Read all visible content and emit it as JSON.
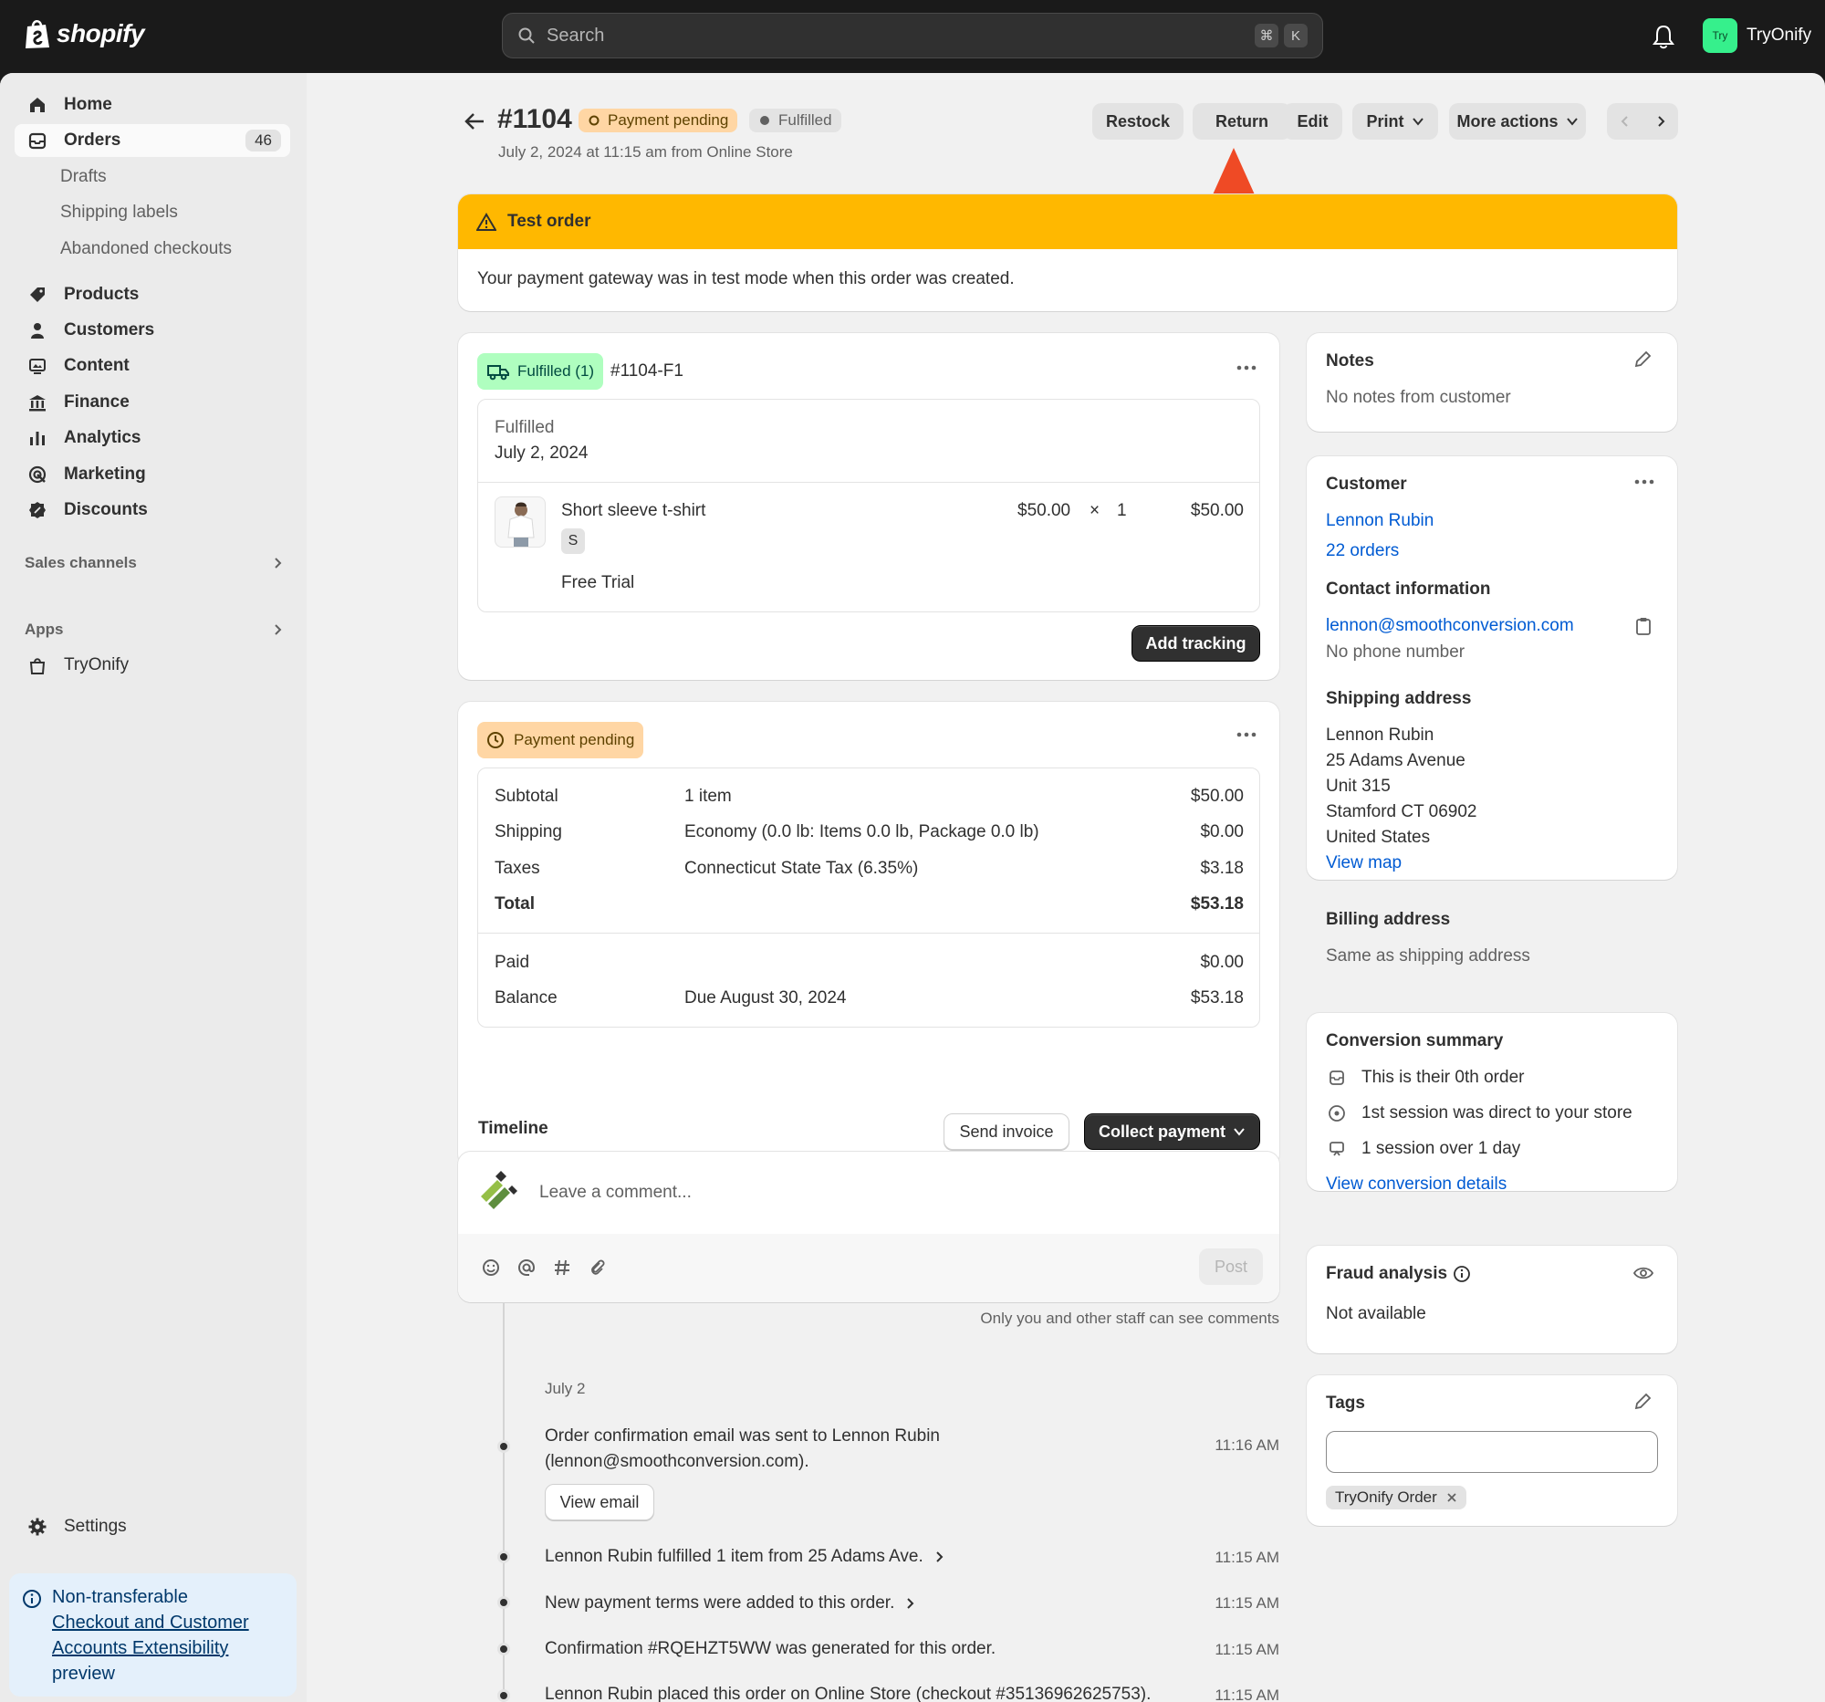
{
  "topbar": {
    "logo_text": "shopify",
    "search_placeholder": "Search",
    "shortcut_keys": [
      "⌘",
      "K"
    ],
    "store_avatar": "Try",
    "store_name": "TryOnify"
  },
  "sidebar": {
    "items": [
      {
        "label": "Home",
        "icon": "home-icon"
      },
      {
        "label": "Orders",
        "icon": "orders-icon",
        "badge": "46"
      },
      {
        "label": "Products",
        "icon": "tag-icon"
      },
      {
        "label": "Customers",
        "icon": "person-icon"
      },
      {
        "label": "Content",
        "icon": "content-icon"
      },
      {
        "label": "Finance",
        "icon": "bank-icon"
      },
      {
        "label": "Analytics",
        "icon": "bar-chart-icon"
      },
      {
        "label": "Marketing",
        "icon": "target-icon"
      },
      {
        "label": "Discounts",
        "icon": "discount-icon"
      }
    ],
    "order_subitems": [
      "Drafts",
      "Shipping labels",
      "Abandoned checkouts"
    ],
    "sales_channels": "Sales channels",
    "apps": "Apps",
    "app_item": "TryOnify",
    "settings": "Settings",
    "promo": {
      "line1": "Non-transferable",
      "link": "Checkout and Customer Accounts Extensibility",
      "line3": "preview"
    }
  },
  "order": {
    "number": "#1104",
    "payment_status": "Payment pending",
    "fulfillment_status": "Fulfilled",
    "subtitle": "July 2, 2024 at 11:15 am from Online Store"
  },
  "actions": {
    "restock": "Restock",
    "return": "Return",
    "edit": "Edit",
    "print": "Print",
    "more": "More actions"
  },
  "test_banner": {
    "title": "Test order",
    "body": "Your payment gateway was in test mode when this order was created."
  },
  "fulfillment": {
    "badge": "Fulfilled (1)",
    "id": "#1104-F1",
    "status": "Fulfilled",
    "date": "July 2, 2024",
    "item": {
      "name": "Short sleeve t-shirt",
      "variant": "S",
      "plan": "Free Trial",
      "price": "$50.00",
      "times": "×",
      "qty": "1",
      "total": "$50.00"
    },
    "add_tracking": "Add tracking"
  },
  "payment": {
    "badge": "Payment pending",
    "rows": [
      {
        "label": "Subtotal",
        "desc": "1 item",
        "amount": "$50.00"
      },
      {
        "label": "Shipping",
        "desc": "Economy (0.0 lb: Items 0.0 lb, Package 0.0 lb)",
        "amount": "$0.00"
      },
      {
        "label": "Taxes",
        "desc": "Connecticut State Tax (6.35%)",
        "amount": "$3.18"
      },
      {
        "label": "Total",
        "desc": "",
        "amount": "$53.18"
      }
    ],
    "paid_label": "Paid",
    "paid_amount": "$0.00",
    "balance_label": "Balance",
    "balance_desc": "Due August 30, 2024",
    "balance_amount": "$53.18",
    "send_invoice": "Send invoice",
    "collect_payment": "Collect payment"
  },
  "timeline": {
    "title": "Timeline",
    "comment_placeholder": "Leave a comment...",
    "post": "Post",
    "staff_note": "Only you and other staff can see comments",
    "date": "July 2",
    "events": [
      {
        "text": "Order confirmation email was sent to Lennon Rubin (lennon@smoothconversion.com).",
        "time": "11:16 AM",
        "action": "View email"
      },
      {
        "text": "Lennon Rubin fulfilled 1 item from 25 Adams Ave.",
        "time": "11:15 AM"
      },
      {
        "text": "New payment terms were added to this order.",
        "time": "11:15 AM"
      },
      {
        "text": "Confirmation #RQEHZT5WW was generated for this order.",
        "time": "11:15 AM"
      },
      {
        "text": "Lennon Rubin placed this order on Online Store (checkout #35136962625753).",
        "time": "11:15 AM"
      }
    ]
  },
  "notes": {
    "title": "Notes",
    "body": "No notes from customer"
  },
  "customer": {
    "title": "Customer",
    "name": "Lennon Rubin",
    "orders": "22 orders",
    "contact_title": "Contact information",
    "email": "lennon@smoothconversion.com",
    "phone": "No phone number",
    "shipping_title": "Shipping address",
    "address": [
      "Lennon Rubin",
      "25 Adams Avenue",
      "Unit 315",
      "Stamford CT 06902",
      "United States"
    ],
    "view_map": "View map",
    "billing_title": "Billing address",
    "billing": "Same as shipping address"
  },
  "conversion": {
    "title": "Conversion summary",
    "lines": [
      "This is their 0th order",
      "1st session was direct to your store",
      "1 session over 1 day"
    ],
    "link": "View conversion details"
  },
  "fraud": {
    "title": "Fraud analysis",
    "body": "Not available"
  },
  "tags": {
    "title": "Tags",
    "tag": "TryOnify Order"
  },
  "colors": {
    "accent_red": "#ef4a25",
    "banner_yellow": "#ffb800",
    "link_blue": "#005bd3",
    "fulfilled_green": "#affebf",
    "pending_orange": "#ffd6a4"
  }
}
